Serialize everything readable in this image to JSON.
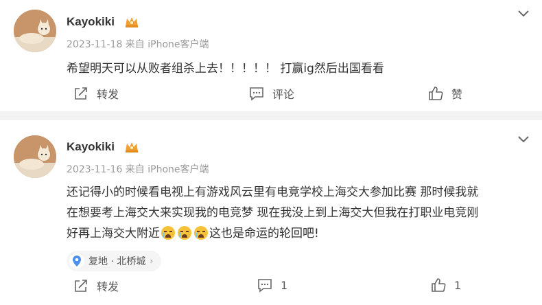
{
  "comments": [
    {
      "user": "Kayokiki",
      "meta": "2023-11-18 来自 iPhone客户端",
      "text": "希望明天可以从败者组杀上去！！！！！ 打赢ig然后出国看看",
      "actions": {
        "share": "转发",
        "comment": "评论",
        "like": "赞"
      }
    },
    {
      "user": "Kayokiki",
      "meta": "2023-11-16 来自 iPhone客户端",
      "text_line1": "还记得小的时候看电视上有游戏风云里有电竞学校上海交大参加比赛 那时候我就",
      "text_line2": "在想要考上海交大来实现我的电竞梦 现在我没上到上海交大但我在打职业电竞刚",
      "text_line3_a": "好再上海交大附近",
      "text_line3_b": "这也是命运的轮回吧!",
      "location": "复地 · 北桥城",
      "actions": {
        "share": "转发",
        "comment": "1",
        "like": "1"
      }
    }
  ],
  "colors": {
    "separator": "#f2f2f2",
    "meta": "#999999",
    "crown": "#f0a030",
    "pin": "#4a8ef0"
  },
  "icons": [
    "cat-avatar",
    "crown-icon",
    "chevron-down-icon",
    "share-icon",
    "comment-icon",
    "like-icon",
    "location-pin-icon",
    "sob-emoji-icon"
  ]
}
